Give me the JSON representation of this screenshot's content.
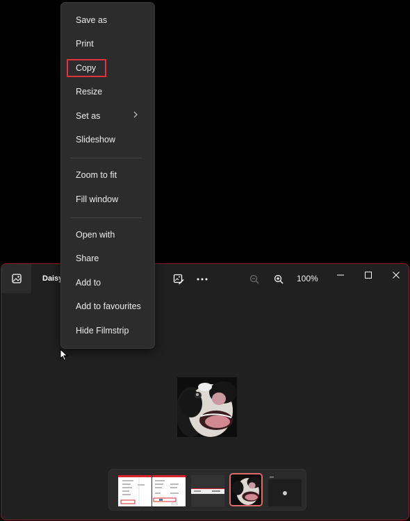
{
  "window": {
    "file_name": "Daisy",
    "zoom_level": "100%",
    "icons": {
      "app": "photo-gallery-icon",
      "edit": "edit-image-icon",
      "more": "more-options-icon",
      "zoom_out": "zoom-out-icon",
      "zoom_in": "zoom-in-icon",
      "minimize": "minimize-icon",
      "maximize": "maximize-icon",
      "close": "close-icon"
    },
    "accent_color": "#8a1e2a"
  },
  "context_menu": {
    "items": [
      {
        "label": "Save as"
      },
      {
        "label": "Print"
      },
      {
        "label": "Copy",
        "highlighted": true
      },
      {
        "label": "Resize"
      },
      {
        "label": "Set as",
        "submenu": true
      },
      {
        "label": "Slideshow"
      },
      {
        "label": "Zoom to fit"
      },
      {
        "label": "Fill window"
      },
      {
        "label": "Open with"
      },
      {
        "label": "Share"
      },
      {
        "label": "Add to"
      },
      {
        "label": "Add to favourites"
      },
      {
        "label": "Hide Filmstrip"
      }
    ],
    "highlight_color": "#e0343c"
  },
  "filmstrip": {
    "thumbnails": [
      {
        "name": "screenshot-menu"
      },
      {
        "name": "screenshot-dialog"
      },
      {
        "name": "screenshot-dark-bar"
      },
      {
        "name": "dog-photo",
        "selected": true
      },
      {
        "name": "screenshot-dark"
      }
    ],
    "selected_border": "#e06b6b"
  }
}
